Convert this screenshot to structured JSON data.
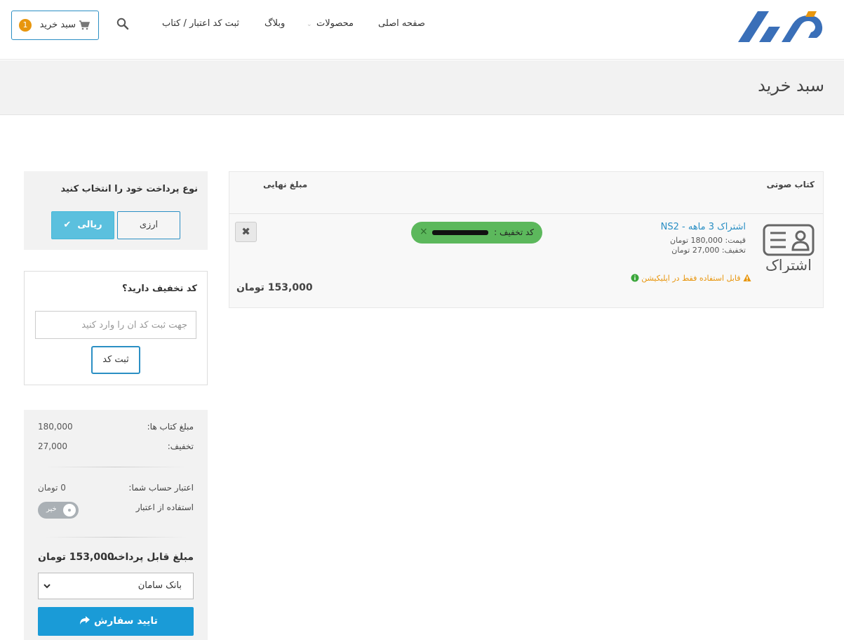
{
  "header": {
    "nav": {
      "home": "صفحه اصلی",
      "products": "محصولات",
      "blog": "وبلاگ",
      "register_code": "ثبت کد اعتبار / کتاب"
    },
    "cart": {
      "label": "سبد خرید",
      "count": "1"
    },
    "icons": [
      "logo",
      "search-icon",
      "cart-icon",
      "chevron-down-icon"
    ]
  },
  "page": {
    "title": "سبد خرید"
  },
  "cart_table": {
    "headers": {
      "product": "کتاب صوتی",
      "final_amount": "مبلغ نهایی"
    },
    "items": [
      {
        "image_text": "اشتراک",
        "title": "اشتراک 3 ماهه - NS2",
        "price": "قیمت: 180,000 تومان",
        "discount": "تخفیف: 27,000 تومان",
        "warning": "قابل استفاده فقط در اپلیکیشن",
        "discount_code_label": "کد تخفیف :",
        "final_price": "153,000 تومان"
      }
    ]
  },
  "payment_type": {
    "title": "نوع پرداخت خود را انتخاب کنید",
    "options": {
      "rial": "ریالی",
      "arzi": "ارزی"
    },
    "selected": "rial"
  },
  "coupon": {
    "title": "کد تخفیف دارید؟",
    "placeholder": "جهت ثبت کد آن را وارد کنید",
    "submit": "ثبت کد"
  },
  "summary": {
    "books_amount_label": "مبلغ کتاب ها:",
    "books_amount": "180,000",
    "discount_label": "تخفیف:",
    "discount": "27,000",
    "credit_label": "اعتبار حساب شما:",
    "credit": "0 تومان",
    "use_credit_label": "استفاده از اعتبار",
    "use_credit_toggle": "خیر",
    "payable_label": "مبلغ قابل پرداخت:",
    "payable": "153,000 تومان",
    "bank": "بانک سامان",
    "confirm": "تایید سفارش"
  },
  "colors": {
    "accent": "#2b8fc4",
    "logo": "#3a6fb8",
    "logo_accent": "#e8960e",
    "discount_pill": "#5cb85c",
    "rial_button": "#5bc0de",
    "confirm_button": "#1a9bd7",
    "warning": "#e8960e"
  }
}
